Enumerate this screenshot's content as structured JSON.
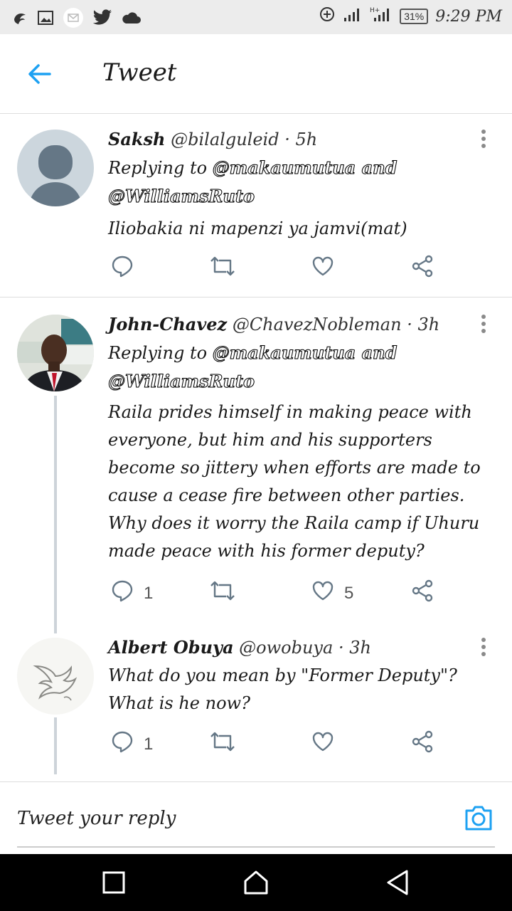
{
  "status_bar": {
    "battery": "31%",
    "time": "9:29 PM"
  },
  "header": {
    "title": "Tweet"
  },
  "tweets": [
    {
      "name": "Saksh",
      "handle": "@bilalguleid",
      "time": "· 5h",
      "replying_prefix": "Replying to ",
      "mentions_line1": "@makaumutua and",
      "mentions_line2": "@WilliamsRuto",
      "text": "Iliobakia ni mapenzi ya jamvi(mat)",
      "reply_count": "",
      "like_count": ""
    },
    {
      "name": "John-Chavez",
      "handle": "@ChavezNobleman",
      "time": "· 3h",
      "replying_prefix": "Replying to ",
      "mentions_line1": "@makaumutua and",
      "mentions_line2": "@WilliamsRuto",
      "text": "Raila prides himself in making peace with everyone, but him and his supporters become so jittery when efforts are made to cause a cease fire between other parties. Why does it worry the Raila camp if Uhuru made peace with his former deputy?",
      "reply_count": "1",
      "like_count": "5"
    },
    {
      "name": "Albert Obuya",
      "handle": "@owobuya",
      "time": "· 3h",
      "text": "What do you mean by \"Former Deputy\"? What is he now?",
      "reply_count": "1",
      "like_count": ""
    }
  ],
  "reply_box": {
    "placeholder": "Tweet your reply"
  },
  "colors": {
    "accent": "#1da1f2",
    "action_gray": "#657786"
  }
}
